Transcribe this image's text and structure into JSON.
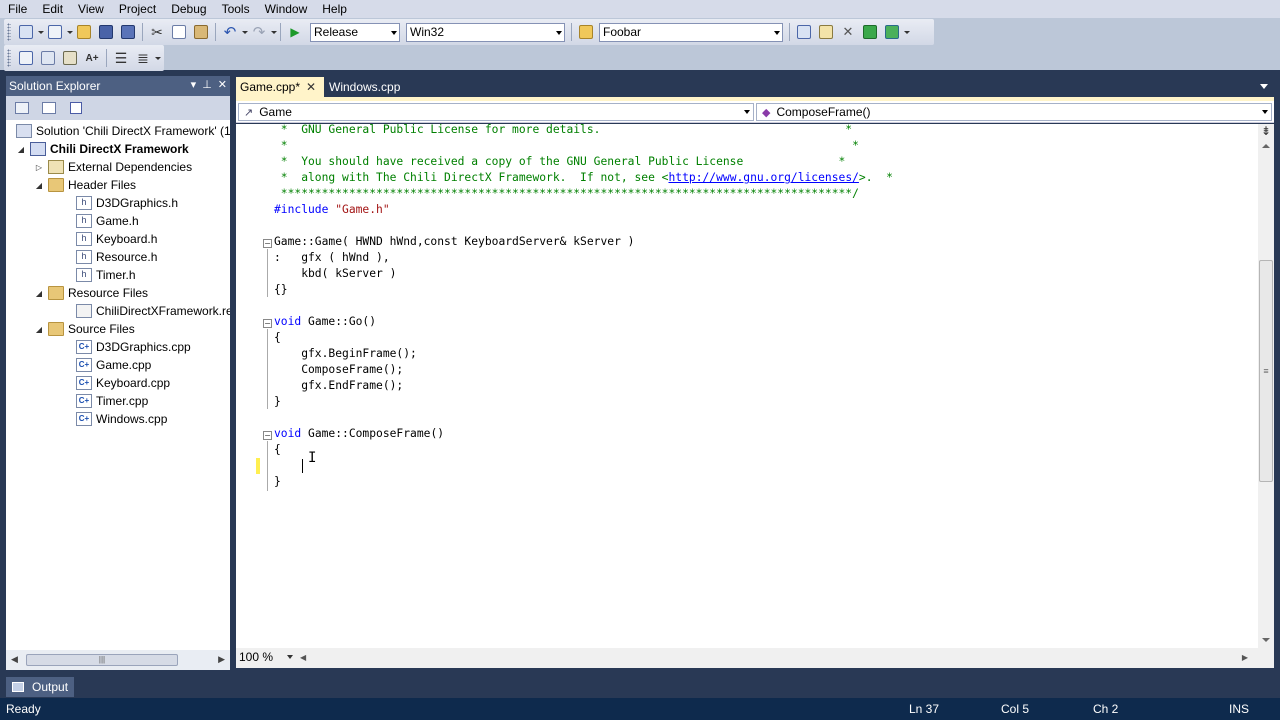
{
  "menu": [
    "File",
    "Edit",
    "View",
    "Project",
    "Debug",
    "Tools",
    "Window",
    "Help"
  ],
  "toolbar": {
    "config": "Release",
    "platform": "Win32",
    "find": "Foobar"
  },
  "solution_explorer": {
    "title": "Solution Explorer",
    "items": [
      {
        "label": "Solution 'Chili DirectX Framework' (1",
        "icon": "solution-icon"
      },
      {
        "label": "Chili DirectX Framework",
        "icon": "project-icon"
      },
      {
        "label": "External Dependencies",
        "icon": "external-dependencies-icon"
      },
      {
        "label": "Header Files",
        "icon": "folder-icon"
      },
      {
        "label": "D3DGraphics.h",
        "icon": "header-file-icon"
      },
      {
        "label": "Game.h",
        "icon": "header-file-icon"
      },
      {
        "label": "Keyboard.h",
        "icon": "header-file-icon"
      },
      {
        "label": "Resource.h",
        "icon": "header-file-icon"
      },
      {
        "label": "Timer.h",
        "icon": "header-file-icon"
      },
      {
        "label": "Resource Files",
        "icon": "folder-icon"
      },
      {
        "label": "ChiliDirectXFramework.re",
        "icon": "resource-file-icon"
      },
      {
        "label": "Source Files",
        "icon": "folder-icon"
      },
      {
        "label": "D3DGraphics.cpp",
        "icon": "cpp-file-icon"
      },
      {
        "label": "Game.cpp",
        "icon": "cpp-file-icon"
      },
      {
        "label": "Keyboard.cpp",
        "icon": "cpp-file-icon"
      },
      {
        "label": "Timer.cpp",
        "icon": "cpp-file-icon"
      },
      {
        "label": "Windows.cpp",
        "icon": "cpp-file-icon"
      }
    ]
  },
  "tabs": [
    {
      "label": "Game.cpp*",
      "active": true
    },
    {
      "label": "Windows.cpp",
      "active": false
    }
  ],
  "nav": {
    "scope": "Game",
    "member": "ComposeFrame()"
  },
  "code": {
    "l1": " *  GNU General Public License for more details.                                    *",
    "l2": " *                                                                                   *",
    "l3": " *  You should have received a copy of the GNU General Public License              *",
    "l4_pre": " *  along with The Chili DirectX Framework.  If not, see <",
    "l4_link": "http://www.gnu.org/licenses/",
    "l4_post": ">.  *",
    "l5": " ************************************************************************************/",
    "include_kw": "#include",
    "include_str": " \"Game.h\"",
    "ctor_sig": "Game::Game( HWND hWnd,const KeyboardServer& kServer )",
    "ctor_init1": ":   gfx ( hWnd ),",
    "ctor_init2": "    kbd( kServer )",
    "ctor_body": "{}",
    "go_kw": "void",
    "go_sig": " Game::Go()",
    "go_open": "{",
    "go_l1": "    gfx.BeginFrame();",
    "go_l2": "    ComposeFrame();",
    "go_l3": "    gfx.EndFrame();",
    "go_close": "}",
    "cf_kw": "void",
    "cf_sig": " Game::ComposeFrame()",
    "cf_open": "{",
    "cf_close": "}"
  },
  "editor": {
    "zoom": "100 %"
  },
  "output_tab": "Output",
  "status": {
    "state": "Ready",
    "ln": "Ln 37",
    "col": "Col 5",
    "ch": "Ch 2",
    "mode": "INS"
  },
  "colors": {
    "chrome": "#293955",
    "active_tab": "#fff4c9",
    "comment": "#008000",
    "keyword": "#0000ff",
    "string": "#a31515"
  }
}
